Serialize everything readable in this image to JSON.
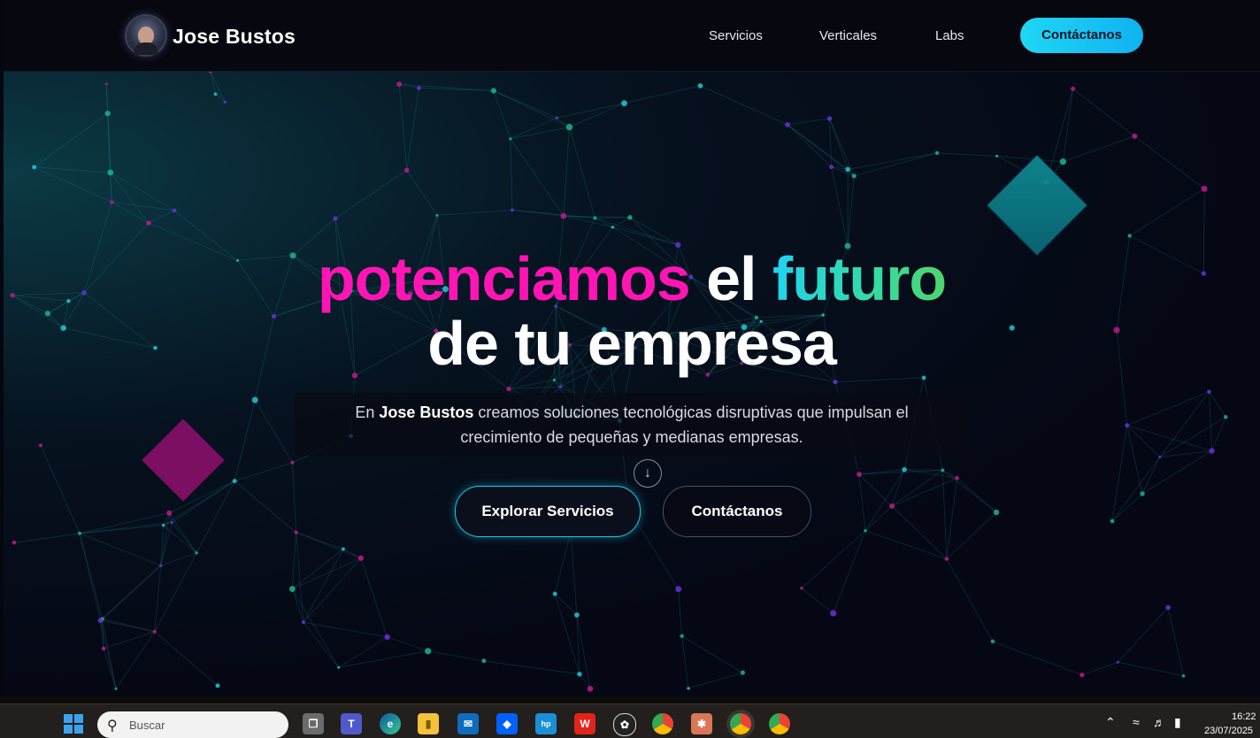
{
  "header": {
    "brand": "Jose Bustos",
    "nav": [
      "Servicios",
      "Verticales",
      "Labs"
    ],
    "cta": "Contáctanos"
  },
  "hero": {
    "word1": "potenciamos",
    "word2": "el",
    "word3": "futuro",
    "line2": "de tu empresa",
    "subtitle_prefix": "En",
    "subtitle_brand": "Jose Bustos",
    "subtitle_rest": "creamos soluciones tecnológicas disruptivas que impulsan el crecimiento de pequeñas y medianas empresas.",
    "scroll_icon": "arrow-down-icon",
    "primary_button": "Explorar Servicios",
    "secondary_button": "Contáctanos"
  },
  "colors": {
    "accent_pink": "#ff14b4",
    "accent_cyan": "#1fd3f0",
    "accent_green": "#4fd36a",
    "background": "#05060f"
  },
  "taskbar": {
    "search_placeholder": "Buscar",
    "apps": [
      "task-view",
      "teams",
      "edge",
      "file-explorer",
      "mail",
      "dropbox",
      "myhp",
      "wps-office",
      "chatgpt",
      "chrome",
      "claude",
      "chrome-profile",
      "chrome-profile-2"
    ],
    "time": "16:22",
    "date": "23/07/2025"
  }
}
